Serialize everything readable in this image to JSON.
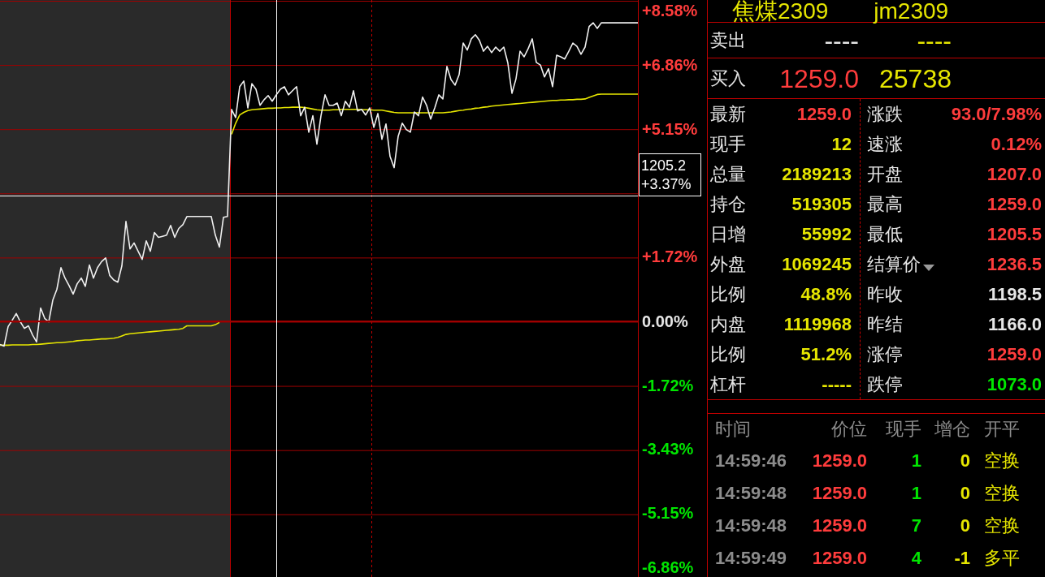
{
  "chart": {
    "crosshair": {
      "price": "1205.2",
      "change": "+3.37%"
    },
    "chart_data": {
      "type": "line",
      "categories": [
        null,
        null,
        null,
        null,
        null,
        null,
        null,
        null,
        null,
        null,
        null,
        null,
        null,
        null,
        null,
        null,
        null,
        null,
        null,
        null,
        null,
        null,
        null,
        null,
        null,
        null,
        null,
        null,
        null,
        null,
        null,
        null,
        null,
        null,
        null,
        null,
        null,
        null,
        null,
        null,
        null,
        null,
        null,
        null,
        null,
        null,
        null,
        null,
        null,
        null,
        null,
        null,
        null,
        null,
        null,
        null,
        null,
        null,
        null,
        null,
        null,
        null,
        null,
        null,
        null,
        null,
        null,
        null,
        null,
        null,
        null,
        null,
        null,
        null,
        null,
        null,
        null,
        null,
        null,
        null,
        null,
        null,
        null,
        null,
        null,
        null,
        null,
        null,
        null,
        null,
        null,
        null,
        null,
        null,
        null,
        null,
        null,
        null,
        null,
        null,
        null,
        null,
        null,
        null,
        null,
        null,
        null,
        null,
        null,
        null,
        null,
        null,
        null,
        null,
        null,
        null,
        null,
        null,
        null,
        null,
        null,
        null,
        null,
        null,
        null,
        null,
        null,
        null,
        null,
        null,
        null,
        null,
        null,
        null,
        null,
        null,
        null,
        null,
        null,
        null,
        null,
        null,
        null,
        null,
        null,
        null,
        null,
        null,
        null,
        null,
        null,
        null,
        null,
        null,
        null,
        null,
        null,
        null
      ],
      "ylim": [
        -6.86,
        8.58
      ],
      "yticks": [
        {
          "value": 8.58,
          "label": "+8.58%"
        },
        {
          "value": 6.86,
          "label": "+6.86%"
        },
        {
          "value": 5.15,
          "label": "+5.15%"
        },
        {
          "value": 1.72,
          "label": "+1.72%"
        },
        {
          "value": 0,
          "label": "0.00%"
        },
        {
          "value": -1.72,
          "label": "-1.72%"
        },
        {
          "value": -3.43,
          "label": "-3.43%"
        },
        {
          "value": -5.15,
          "label": "-5.15%"
        },
        {
          "value": -6.86,
          "label": "-6.86%"
        }
      ],
      "grid": true,
      "series": [
        {
          "color": "#f0f0f0",
          "values": [
            -0.63,
            -0.67,
            -0.15,
            0.02,
            0.2,
            -0.02,
            -0.2,
            -0.13,
            -0.37,
            -0.56,
            0.35,
            0.07,
            -0.02,
            0.56,
            0.85,
            1.43,
            1.15,
            0.95,
            0.72,
            1.0,
            1.15,
            0.93,
            1.5,
            1.15,
            1.43,
            1.59,
            1.69,
            1.22,
            1.1,
            1.04,
            1.48,
            2.67,
            1.93,
            2.09,
            1.87,
            1.65,
            2.15,
            1.87,
            2.37,
            2.24,
            2.27,
            2.3,
            2.56,
            2.24,
            2.48,
            2.58,
            2.8,
            2.8,
            2.8,
            2.8,
            2.8,
            2.8,
            2.8,
            2.3,
            1.98,
            2.78,
            2.8,
            5.67,
            5.45,
            6.28,
            6.43,
            5.71,
            6.36,
            6.21,
            5.78,
            5.93,
            6.04,
            5.89,
            6.06,
            6.21,
            6.28,
            6.06,
            6.17,
            6.28,
            5.5,
            5.73,
            5.06,
            5.5,
            4.74,
            5.5,
            6.06,
            5.78,
            5.78,
            5.84,
            5.5,
            5.89,
            5.73,
            6.17,
            5.63,
            5.67,
            5.52,
            5.71,
            5.19,
            5.56,
            4.87,
            5.28,
            4.41,
            4.11,
            4.95,
            5.3,
            5.13,
            5.06,
            5.6,
            5.5,
            6.0,
            5.78,
            5.41,
            5.71,
            6.06,
            5.95,
            6.82,
            6.47,
            6.32,
            6.6,
            7.45,
            7.26,
            7.56,
            7.67,
            7.52,
            7.23,
            7.36,
            7.19,
            7.34,
            7.23,
            7.34,
            6.91,
            6.1,
            6.49,
            7.23,
            7.08,
            7.3,
            7.56,
            6.93,
            6.86,
            6.54,
            6.76,
            6.28,
            7.12,
            7.08,
            7.02,
            7.23,
            7.45,
            7.36,
            7.15,
            7.34,
            7.89,
            7.99,
            7.84,
            7.99,
            7.99,
            7.99,
            7.99,
            7.99,
            7.99,
            7.99,
            7.99,
            7.99,
            7.99
          ]
        },
        {
          "color": "#e6e600",
          "values": [
            -0.65,
            -0.65,
            -0.65,
            -0.64,
            -0.64,
            -0.64,
            -0.64,
            -0.64,
            -0.63,
            -0.63,
            -0.62,
            -0.61,
            -0.6,
            -0.59,
            -0.58,
            -0.58,
            -0.57,
            -0.56,
            -0.55,
            -0.53,
            -0.52,
            -0.51,
            -0.51,
            -0.5,
            -0.49,
            -0.48,
            -0.48,
            -0.47,
            -0.46,
            -0.44,
            -0.4,
            -0.36,
            -0.34,
            -0.33,
            -0.32,
            -0.31,
            -0.3,
            -0.29,
            -0.28,
            -0.27,
            -0.26,
            -0.25,
            -0.24,
            -0.23,
            -0.22,
            -0.2,
            -0.13,
            -0.13,
            -0.13,
            -0.13,
            -0.13,
            -0.13,
            -0.13,
            -0.1,
            -0.04,
            null,
            null,
            5.0,
            5.3,
            5.52,
            5.59,
            5.64,
            5.66,
            5.67,
            5.68,
            5.69,
            5.7,
            5.7,
            5.71,
            5.71,
            5.72,
            5.72,
            5.73,
            5.73,
            5.73,
            5.72,
            5.7,
            5.68,
            5.66,
            5.65,
            5.65,
            5.65,
            5.66,
            5.66,
            5.67,
            5.67,
            5.67,
            5.67,
            5.67,
            5.66,
            5.66,
            5.66,
            5.65,
            5.65,
            5.65,
            5.63,
            5.61,
            5.59,
            5.58,
            5.58,
            5.58,
            5.58,
            5.58,
            5.58,
            5.58,
            5.58,
            5.58,
            5.58,
            5.58,
            5.58,
            5.59,
            5.6,
            5.62,
            5.64,
            5.65,
            5.67,
            5.68,
            5.7,
            5.71,
            5.73,
            5.74,
            5.76,
            5.77,
            5.78,
            5.79,
            5.8,
            5.81,
            5.82,
            5.83,
            5.84,
            5.85,
            5.86,
            5.87,
            5.88,
            5.89,
            5.9,
            5.91,
            5.91,
            5.92,
            5.92,
            5.93,
            5.93,
            5.94,
            5.94,
            5.95,
            5.99,
            6.03,
            6.07,
            6.08,
            6.08,
            6.08,
            6.08,
            6.08,
            6.08,
            6.08,
            6.08,
            6.08,
            6.08
          ]
        }
      ]
    }
  },
  "quote": {
    "title": {
      "name": "焦煤2309",
      "code": "jm2309"
    },
    "ask": {
      "label": "卖出",
      "price": {
        "text": "----",
        "color": "#e6e6e6"
      },
      "volume": {
        "text": "----",
        "color": "#e6e600"
      }
    },
    "bid": {
      "label": "买入",
      "price": {
        "text": "1259.0",
        "color": "#ff3c3c"
      },
      "volume": {
        "text": "25738",
        "color": "#e6e600"
      }
    },
    "left": [
      {
        "label": "最新",
        "value": "1259.0",
        "color": "#ff3c3c"
      },
      {
        "label": "现手",
        "value": "12",
        "color": "#e6e600"
      },
      {
        "label": "总量",
        "value": "2189213",
        "color": "#e6e600"
      },
      {
        "label": "持仓",
        "value": "519305",
        "color": "#e6e600"
      },
      {
        "label": "日增",
        "value": "55992",
        "color": "#e6e600"
      },
      {
        "label": "外盘",
        "value": "1069245",
        "color": "#e6e600"
      },
      {
        "label": "比例",
        "value": "48.8%",
        "color": "#e6e600"
      },
      {
        "label": "内盘",
        "value": "1119968",
        "color": "#e6e600"
      },
      {
        "label": "比例",
        "value": "51.2%",
        "color": "#e6e600"
      },
      {
        "label": "杠杆",
        "value": "-----",
        "color": "#e6e600"
      }
    ],
    "right": [
      {
        "label": "涨跌",
        "value": "93.0/7.98%",
        "color": "#ff3c3c",
        "kind": "plain"
      },
      {
        "label": "速涨",
        "value": "0.12%",
        "color": "#ff3c3c",
        "kind": "plain"
      },
      {
        "label": "开盘",
        "value": "1207.0",
        "color": "#ff3c3c",
        "kind": "plain"
      },
      {
        "label": "最高",
        "value": "1259.0",
        "color": "#ff3c3c",
        "kind": "plain"
      },
      {
        "label": "最低",
        "value": "1205.5",
        "color": "#ff3c3c",
        "kind": "plain"
      },
      {
        "label": "结算价",
        "value": "1236.5",
        "color": "#ff3c3c",
        "kind": "select"
      },
      {
        "label": "昨收",
        "value": "1198.5",
        "color": "#e6e6e6",
        "kind": "plain"
      },
      {
        "label": "昨结",
        "value": "1166.0",
        "color": "#e6e6e6",
        "kind": "plain"
      },
      {
        "label": "涨停",
        "value": "1259.0",
        "color": "#ff3c3c",
        "kind": "plain"
      },
      {
        "label": "跌停",
        "value": "1073.0",
        "color": "#00e600",
        "kind": "plain"
      }
    ]
  },
  "trades": {
    "columns": [
      "时间",
      "价位",
      "现手",
      "增仓",
      "开平"
    ],
    "rows": [
      {
        "time": "14:59:46",
        "price": "1259.0",
        "volume": "1",
        "oi_change": "0",
        "action": "空换"
      },
      {
        "time": "14:59:48",
        "price": "1259.0",
        "volume": "1",
        "oi_change": "0",
        "action": "空换"
      },
      {
        "time": "14:59:48",
        "price": "1259.0",
        "volume": "7",
        "oi_change": "0",
        "action": "空换"
      },
      {
        "time": "14:59:49",
        "price": "1259.0",
        "volume": "4",
        "oi_change": "-1",
        "action": "多平"
      }
    ]
  }
}
